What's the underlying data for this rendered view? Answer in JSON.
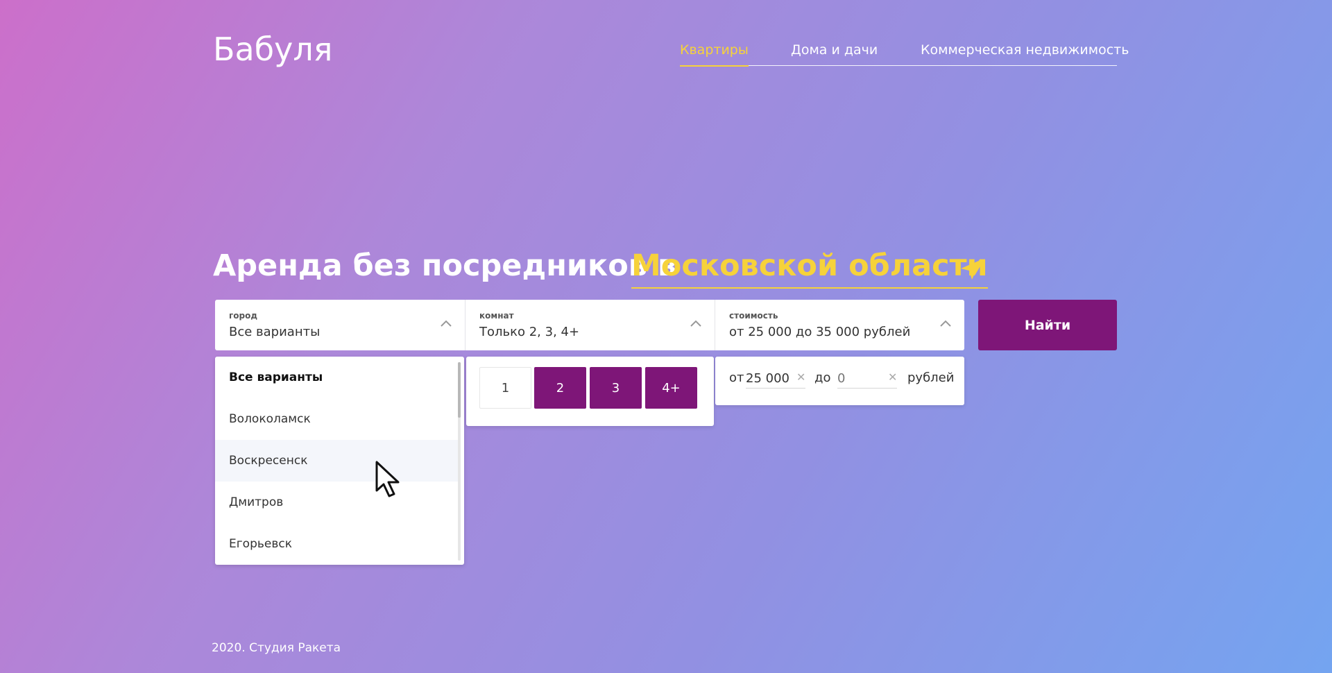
{
  "logo": "Бабуля",
  "nav": {
    "items": [
      "Квартиры",
      "Дома и дачи",
      "Коммерческая недвижимость"
    ]
  },
  "headline": {
    "text": "Аренда без посредников в",
    "region": "Московской области"
  },
  "filters": {
    "city": {
      "label": "город",
      "value": "Все варианты"
    },
    "rooms": {
      "label": "комнат",
      "value": "Только  2, 3, 4+"
    },
    "price": {
      "label": "стоимость",
      "value": "от 25 000 до 35 000 рублей"
    }
  },
  "search_button": "Найти",
  "city_dropdown": {
    "items": [
      "Все варианты",
      "Волоколамск",
      "Воскресенск",
      "Дмитров",
      "Егорьевск"
    ]
  },
  "rooms_panel": {
    "options": [
      "1",
      "2",
      "3",
      "4+"
    ],
    "selected": [
      "2",
      "3",
      "4+"
    ]
  },
  "price_panel": {
    "from_label": "от",
    "from_value": "25 000",
    "to_label": "до",
    "to_placeholder": "0",
    "unit": "рублей"
  },
  "footer": "2020. Студия Ракета",
  "colors": {
    "accent": "#f6d23a",
    "primary": "#7e1678"
  }
}
